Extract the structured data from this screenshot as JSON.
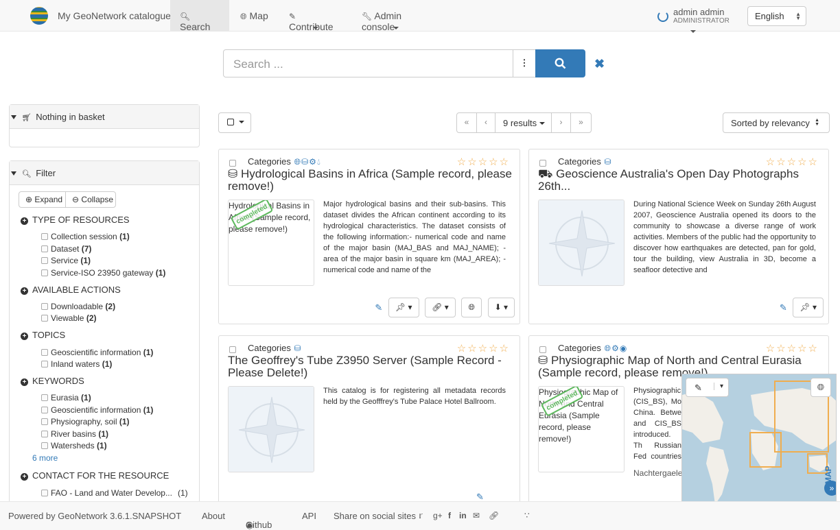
{
  "navbar": {
    "brand": "My GeoNetwork catalogue",
    "search": "Search",
    "map": "Map",
    "contribute": "Contribute",
    "admin": "Admin console",
    "user_name": "admin admin",
    "user_role": "ADMINISTRATOR",
    "language": "English"
  },
  "search": {
    "placeholder": "Search ..."
  },
  "toolbar": {
    "results": "9 results",
    "sort": "Sorted by relevancy"
  },
  "basket": {
    "label": "Nothing in basket"
  },
  "filter": {
    "label": "Filter",
    "expand": "Expand",
    "collapse": "Collapse",
    "groups": [
      {
        "title": "TYPE OF RESOURCES",
        "items": [
          {
            "label": "Collection session",
            "count": "(1)"
          },
          {
            "label": "Dataset",
            "count": "(7)"
          },
          {
            "label": "Service",
            "count": "(1)"
          },
          {
            "label": "Service-ISO 23950 gateway",
            "count": "(1)"
          }
        ]
      },
      {
        "title": "AVAILABLE ACTIONS",
        "items": [
          {
            "label": "Downloadable",
            "count": "(2)"
          },
          {
            "label": "Viewable",
            "count": "(2)"
          }
        ]
      },
      {
        "title": "TOPICS",
        "items": [
          {
            "label": "Geoscientific information",
            "count": "(1)"
          },
          {
            "label": "Inland waters",
            "count": "(1)"
          }
        ]
      },
      {
        "title": "KEYWORDS",
        "items": [
          {
            "label": "Eurasia",
            "count": "(1)"
          },
          {
            "label": "Geoscientific information",
            "count": "(1)"
          },
          {
            "label": "Physiography, soil",
            "count": "(1)"
          },
          {
            "label": "River basins",
            "count": "(1)"
          },
          {
            "label": "Watersheds",
            "count": "(1)"
          }
        ],
        "more": "6  more"
      },
      {
        "title": "CONTACT FOR THE RESOURCE",
        "items": [
          {
            "label": "FAO - Land and Water Develop...",
            "count": "(1)"
          }
        ]
      }
    ]
  },
  "records": [
    {
      "categories": "Categories",
      "title": "Hydrological Basins in Africa (Sample record, please remove!)",
      "thumb_alt": "Hydrological Basins in Africa (Sample record, please remove!)",
      "status": "completed",
      "abstract": "Major hydrological basins and their sub-basins. This dataset divides the African continent according to its hydrological characteristics. The dataset consists of the following information:- numerical code and name of the major basin (MAJ_BAS and MAJ_NAME); - area of the major basin in square km (MAJ_AREA); - numerical code and name of the"
    },
    {
      "categories": "Categories",
      "title": "Geoscience Australia's Open Day Photographs 26th...",
      "abstract": "During National Science Week on Sunday 26th August 2007, Geoscience Australia opened its doors to the community to showcase a diverse range of work activities. Members of the public had the opportunity to discover how earthquakes are detected, pan for gold, tour the building, view Australia in 3D, become a seafloor detective and"
    },
    {
      "categories": "Categories",
      "title": "The Geoffrey's Tube Z3950 Server (Sample Record - Please Delete!)",
      "abstract": "This catalog is for registering all metadata records held by the Geofffrey's Tube Palace Hotel Ballroom."
    },
    {
      "categories": "Categories",
      "title": "Physiographic Map of North and Central Eurasia (Sample record, please remove!)",
      "thumb_alt": "Physiographic Map of North and Central Eurasia (Sample record, please remove!)",
      "status": "completed",
      "abstract": "Physiographic (CIS_BS), Mo China. Betwe and CIS_BS introduced. Th Russian Fed countries of th",
      "author": "Nachtergaele"
    }
  ],
  "map_panel": {
    "label": "MAP",
    "info": "i"
  },
  "footer": {
    "powered": "Powered by GeoNetwork 3.6.1.SNAPSHOT",
    "about": "About",
    "github": "Github",
    "api": "API",
    "share": "Share on social sites"
  }
}
